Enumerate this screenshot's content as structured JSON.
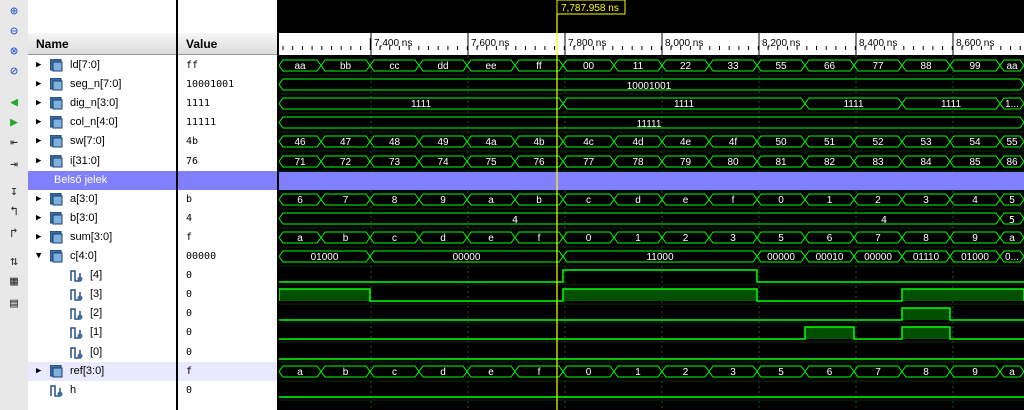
{
  "toolbar": {
    "icons": [
      "zoom-in-icon",
      "zoom-out-icon",
      "zoom-fit-icon",
      "zoom-cursor-icon",
      "go-to-start-icon",
      "go-to-end-icon",
      "previous-transition-icon",
      "next-transition-icon",
      "add-marker-icon",
      "previous-marker-icon",
      "next-marker-icon",
      "swap-cursors-icon",
      "radix-icon",
      "toggle-view-icon"
    ]
  },
  "headers": {
    "name": "Name",
    "value": "Value"
  },
  "cursor": {
    "label": "7,787.958 ns",
    "color": "#ffff00"
  },
  "colors": {
    "wave": "#00ff00",
    "cursor": "#ffff00",
    "group": "#8080ff",
    "bus_fill": "#005000"
  },
  "timeline": {
    "ticks": [
      "7,400 ns",
      "7,600 ns",
      "7,800 ns",
      "8,000 ns",
      "8,200 ns",
      "8,400 ns",
      "8,600 ns"
    ]
  },
  "signals": [
    {
      "name": "ld[7:0]",
      "value": "ff",
      "kind": "bus",
      "expand": "collapsed",
      "bus_values": [
        "aa",
        "bb",
        "cc",
        "dd",
        "ee",
        "ff",
        "00",
        "11",
        "22",
        "33",
        "55",
        "66",
        "77",
        "88",
        "99",
        "aa"
      ]
    },
    {
      "name": "seg_n[7:0]",
      "value": "10001001",
      "kind": "bus",
      "expand": "collapsed",
      "bus_values": [
        "10001001"
      ]
    },
    {
      "name": "dig_n[3:0]",
      "value": "1111",
      "kind": "bus",
      "expand": "collapsed",
      "bus_values": [
        "1111",
        "1111",
        "1111",
        "1111",
        "1..."
      ]
    },
    {
      "name": "col_n[4:0]",
      "value": "11111",
      "kind": "bus",
      "expand": "collapsed",
      "bus_values": [
        "11111"
      ]
    },
    {
      "name": "sw[7:0]",
      "value": "4b",
      "kind": "bus",
      "expand": "collapsed",
      "bus_values": [
        "46",
        "47",
        "48",
        "49",
        "4a",
        "4b",
        "4c",
        "4d",
        "4e",
        "4f",
        "50",
        "51",
        "52",
        "53",
        "54",
        "55"
      ]
    },
    {
      "name": "i[31:0]",
      "value": "76",
      "kind": "bus",
      "expand": "collapsed",
      "bus_values": [
        "71",
        "72",
        "73",
        "74",
        "75",
        "76",
        "77",
        "78",
        "79",
        "80",
        "81",
        "82",
        "83",
        "84",
        "85",
        "86"
      ]
    },
    {
      "name": "Belső jelek",
      "value": "",
      "kind": "group"
    },
    {
      "name": "a[3:0]",
      "value": "b",
      "kind": "bus",
      "expand": "collapsed",
      "bus_values": [
        "6",
        "7",
        "8",
        "9",
        "a",
        "b",
        "c",
        "d",
        "e",
        "f",
        "0",
        "1",
        "2",
        "3",
        "4",
        "5"
      ]
    },
    {
      "name": "b[3:0]",
      "value": "4",
      "kind": "bus",
      "expand": "collapsed",
      "bus_values": [
        "4",
        "5"
      ]
    },
    {
      "name": "sum[3:0]",
      "value": "f",
      "kind": "bus",
      "expand": "collapsed",
      "bus_values": [
        "a",
        "b",
        "c",
        "d",
        "e",
        "f",
        "0",
        "1",
        "2",
        "3",
        "5",
        "6",
        "7",
        "8",
        "9",
        "a"
      ]
    },
    {
      "name": "c[4:0]",
      "value": "00000",
      "kind": "bus",
      "expand": "expanded",
      "bus_values": [
        "01000",
        "00000",
        "11000",
        "00000",
        "00010",
        "00000",
        "01110",
        "01000",
        "0..."
      ]
    },
    {
      "name": "[4]",
      "value": "0",
      "kind": "bit"
    },
    {
      "name": "[3]",
      "value": "0",
      "kind": "bit"
    },
    {
      "name": "[2]",
      "value": "0",
      "kind": "bit"
    },
    {
      "name": "[1]",
      "value": "0",
      "kind": "bit"
    },
    {
      "name": "[0]",
      "value": "0",
      "kind": "bit"
    },
    {
      "name": "ref[3:0]",
      "value": "f",
      "kind": "bus",
      "expand": "collapsed",
      "bus_values": [
        "a",
        "b",
        "c",
        "d",
        "e",
        "f",
        "0",
        "1",
        "2",
        "3",
        "5",
        "6",
        "7",
        "8",
        "9",
        "a"
      ]
    },
    {
      "name": "h",
      "value": "0",
      "kind": "bit"
    }
  ]
}
